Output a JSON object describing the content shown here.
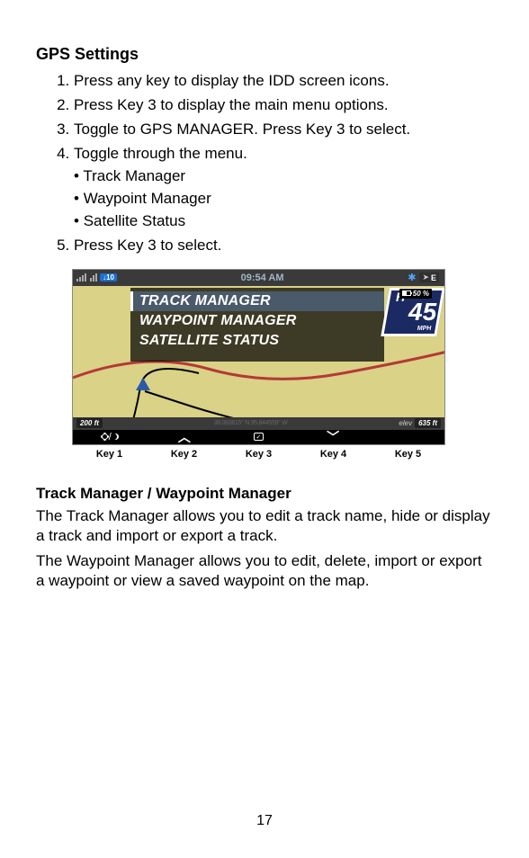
{
  "heading1": "GPS Settings",
  "steps": {
    "s1": "Press any key to display the IDD screen icons.",
    "s2": "Press Key 3 to display the main menu options.",
    "s3": "Toggle to GPS MANAGER. Press Key 3 to select.",
    "s4": "Toggle through the menu.",
    "s5": "Press Key 3 to select."
  },
  "submenu": {
    "a": "Track Manager",
    "b": "Waypoint Manager",
    "c": "Satellite Status"
  },
  "screen": {
    "temp": "10",
    "time": "09:54 AM",
    "compass_dir": "E",
    "menu": {
      "track": "TRACK MANAGER",
      "waypoint": "WAYPOINT MANAGER",
      "satellite": "SATELLITE STATUS"
    },
    "heading_letter": "H",
    "heading_value": "45",
    "heading_unit": "MPH",
    "batt_pct": "50 %",
    "scale": "200 ft",
    "coords": "38.083815° N 95.844559° W",
    "elev_label": "elev",
    "elev_value": "635 ft"
  },
  "keys": {
    "k1": "Key 1",
    "k2": "Key 2",
    "k3": "Key 3",
    "k4": "Key 4",
    "k5": "Key 5"
  },
  "heading2": "Track Manager / Waypoint Manager",
  "para1": "The Track Manager allows you to edit a track name, hide or display a track and import or export a track.",
  "para2": "The Waypoint Manager allows you to edit, delete, import or export a waypoint or view a saved waypoint on the map.",
  "page_number": "17"
}
